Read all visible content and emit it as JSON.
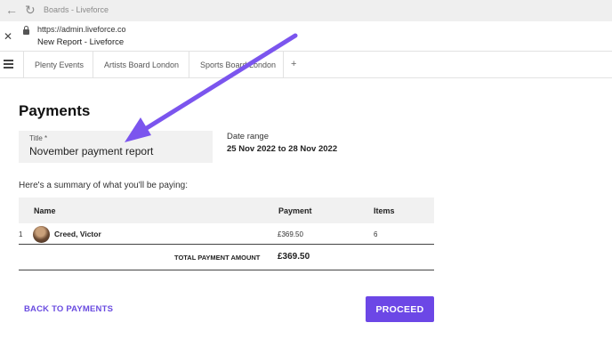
{
  "browser": {
    "window_title": "Boards - Liveforce",
    "url": "https://admin.liveforce.co",
    "page_title": "New Report - Liveforce"
  },
  "tabs": [
    {
      "label": "Plenty Events"
    },
    {
      "label": "Artists Board London"
    },
    {
      "label": "Sports Board London"
    }
  ],
  "tabs_add": "+",
  "page": {
    "heading": "Payments",
    "title_label": "Title *",
    "title_value": "November payment report",
    "date_range_label": "Date range",
    "date_range_value": "25 Nov 2022 to 28 Nov 2022",
    "summary_text": "Here's a summary of what you'll be paying:"
  },
  "table": {
    "columns": [
      "Name",
      "Payment",
      "Items"
    ],
    "rows": [
      {
        "index": "1",
        "name": "Creed, Victor",
        "payment": "£369.50",
        "items": "6"
      }
    ],
    "total_label": "TOTAL PAYMENT AMOUNT",
    "total_value": "£369.50"
  },
  "actions": {
    "back_label": "BACK TO PAYMENTS",
    "proceed_label": "PROCEED"
  },
  "colors": {
    "accent": "#6c47e6",
    "arrow": "#7b55ee"
  },
  "icons": [
    "back-arrow-icon",
    "reload-icon",
    "close-icon",
    "lock-icon",
    "hamburger-menu-icon",
    "plus-icon"
  ]
}
